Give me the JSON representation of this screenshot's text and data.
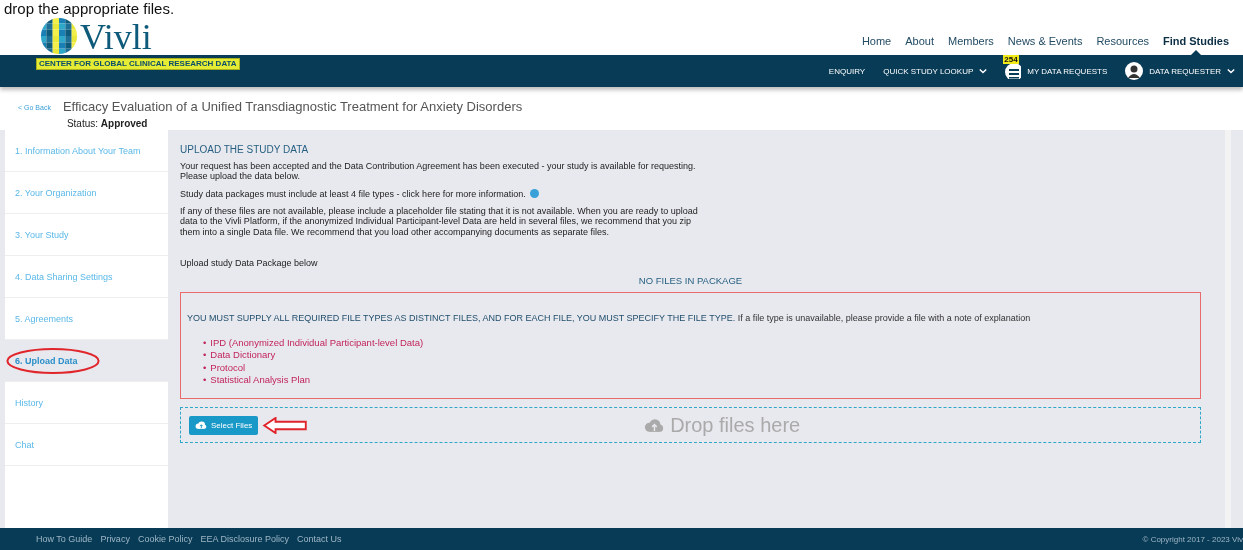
{
  "caption": "drop the appropriate files.",
  "logo": {
    "name": "Vivli",
    "tagline": "CENTER FOR GLOBAL CLINICAL RESEARCH DATA"
  },
  "top_nav": [
    {
      "label": "Home",
      "selected": false
    },
    {
      "label": "About",
      "selected": false
    },
    {
      "label": "Members",
      "selected": false
    },
    {
      "label": "News & Events",
      "selected": false
    },
    {
      "label": "Resources",
      "selected": false
    },
    {
      "label": "Find Studies",
      "selected": true
    }
  ],
  "sub_nav": [
    {
      "kind": "link",
      "label": "ENQUIRY"
    },
    {
      "kind": "dropdown",
      "label": "QUICK STUDY LOOKUP"
    },
    {
      "kind": "badge",
      "label": "MY DATA REQUESTS",
      "badge": "254"
    },
    {
      "kind": "user",
      "label": "DATA REQUESTER"
    }
  ],
  "back_link": "< Go Back",
  "study_title": "Efficacy Evaluation of a Unified Transdiagnostic Treatment for Anxiety Disorders",
  "status": {
    "label": "Status:",
    "value": "Approved"
  },
  "sidebar": [
    {
      "label": "1. Information About Your Team",
      "selected": false,
      "circled": false
    },
    {
      "label": "2. Your Organization",
      "selected": false,
      "circled": false
    },
    {
      "label": "3. Your Study",
      "selected": false,
      "circled": false
    },
    {
      "label": "4. Data Sharing Settings",
      "selected": false,
      "circled": false
    },
    {
      "label": "5. Agreements",
      "selected": false,
      "circled": false
    },
    {
      "label": "6. Upload Data",
      "selected": true,
      "circled": true
    },
    {
      "label": "History",
      "selected": false,
      "circled": false
    },
    {
      "label": "Chat",
      "selected": false,
      "circled": false
    }
  ],
  "content": {
    "heading": "UPLOAD THE STUDY DATA",
    "paragraphs": [
      {
        "text": "Your request has been accepted and the Data Contribution Agreement has been executed - your study is available for requesting. Please upload the data below.",
        "info": false
      },
      {
        "text": "Study data packages must include at least 4 file types - click here for more information.",
        "info": true
      },
      {
        "text": "If any of these files are not available, please include a placeholder file stating that it is not available. When you are ready to upload data to the Vivli Platform, if the anonymized Individual Participant-level Data are held in several files, we recommend that you zip them into a single Data file. We recommend that you load other accompanying documents as separate files.",
        "info": false
      }
    ],
    "upload_label": "Upload study Data Package below",
    "package_status": "NO FILES IN PACKAGE",
    "warning": {
      "lead": "YOU MUST SUPPLY ALL REQUIRED FILE TYPES AS DISTINCT FILES, AND FOR EACH FILE, YOU MUST SPECIFY THE FILE TYPE.",
      "rest": "If a file type is unavailable, please provide a file with a note of explanation",
      "bullet": "•",
      "items": [
        "IPD (Anonymized Individual Participant-level Data)",
        "Data Dictionary",
        "Protocol",
        "Statistical Analysis Plan"
      ]
    },
    "dropzone": {
      "button": "Select Files",
      "placeholder": "Drop files here",
      "arrow": true
    }
  },
  "footer": {
    "links": [
      "How To Guide",
      "Privacy",
      "Cookie Policy",
      "EEA Disclosure Policy",
      "Contact Us"
    ],
    "copyright": "© Copyright 2017 - 2023 Viv"
  }
}
